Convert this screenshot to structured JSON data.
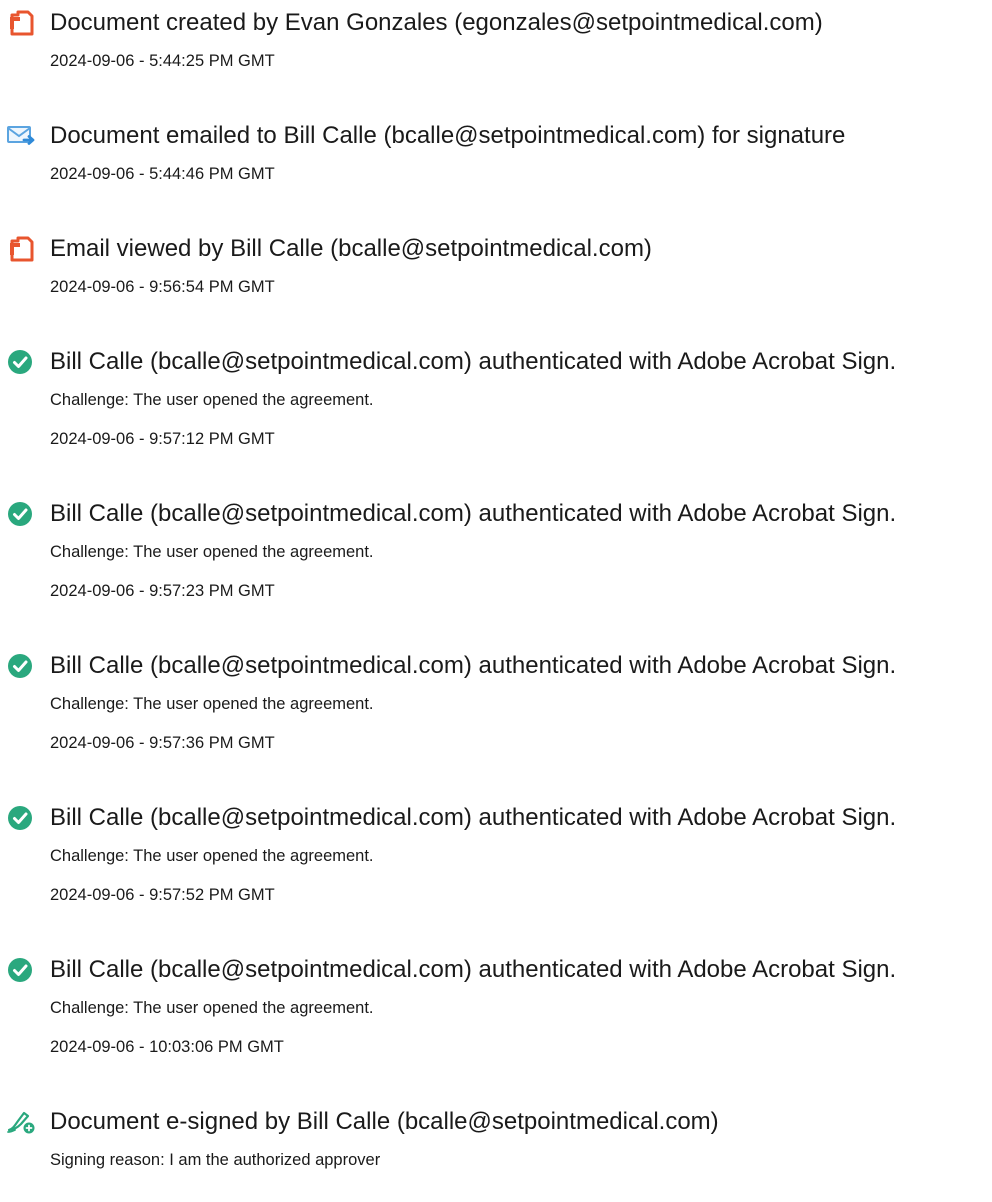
{
  "events": [
    {
      "icon": "document-icon",
      "title": "Document created by Evan Gonzales (egonzales@setpointmedical.com)",
      "lines": [
        "2024-09-06 - 5:44:25 PM GMT"
      ]
    },
    {
      "icon": "email-sent-icon",
      "title": "Document emailed to Bill Calle (bcalle@setpointmedical.com) for signature",
      "lines": [
        "2024-09-06 - 5:44:46 PM GMT"
      ]
    },
    {
      "icon": "document-icon",
      "title": "Email viewed by Bill Calle (bcalle@setpointmedical.com)",
      "lines": [
        "2024-09-06 - 9:56:54 PM GMT"
      ]
    },
    {
      "icon": "checkmark-icon",
      "title": "Bill Calle (bcalle@setpointmedical.com) authenticated with Adobe Acrobat Sign.",
      "lines": [
        "Challenge: The user opened the agreement.",
        "2024-09-06 - 9:57:12 PM GMT"
      ]
    },
    {
      "icon": "checkmark-icon",
      "title": "Bill Calle (bcalle@setpointmedical.com) authenticated with Adobe Acrobat Sign.",
      "lines": [
        "Challenge: The user opened the agreement.",
        "2024-09-06 - 9:57:23 PM GMT"
      ]
    },
    {
      "icon": "checkmark-icon",
      "title": "Bill Calle (bcalle@setpointmedical.com) authenticated with Adobe Acrobat Sign.",
      "lines": [
        "Challenge: The user opened the agreement.",
        "2024-09-06 - 9:57:36 PM GMT"
      ]
    },
    {
      "icon": "checkmark-icon",
      "title": "Bill Calle (bcalle@setpointmedical.com) authenticated with Adobe Acrobat Sign.",
      "lines": [
        "Challenge: The user opened the agreement.",
        "2024-09-06 - 9:57:52 PM GMT"
      ]
    },
    {
      "icon": "checkmark-icon",
      "title": "Bill Calle (bcalle@setpointmedical.com) authenticated with Adobe Acrobat Sign.",
      "lines": [
        "Challenge: The user opened the agreement.",
        "2024-09-06 - 10:03:06 PM GMT"
      ]
    },
    {
      "icon": "signature-pen-icon",
      "title": "Document e-signed by Bill Calle (bcalle@setpointmedical.com)",
      "lines": [
        "Signing reason: I am the authorized approver"
      ]
    }
  ]
}
